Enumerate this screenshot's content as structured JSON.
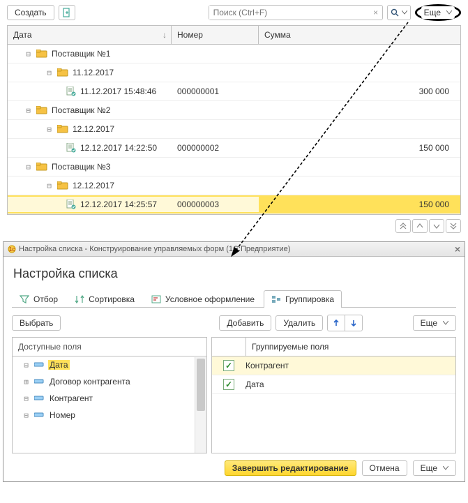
{
  "toolbar": {
    "create_label": "Создать",
    "search_placeholder": "Поиск (Ctrl+F)",
    "more_label": "Еще"
  },
  "columns": {
    "date": "Дата",
    "number": "Номер",
    "sum": "Сумма"
  },
  "rows": [
    {
      "level": 1,
      "kind": "group-supplier",
      "toggle": "-",
      "label": "Поставщик №1"
    },
    {
      "level": 2,
      "kind": "group-date",
      "toggle": "-",
      "label": "11.12.2017"
    },
    {
      "level": 3,
      "kind": "doc",
      "date": "11.12.2017 15:48:46",
      "number": "000000001",
      "sum": "300 000"
    },
    {
      "level": 1,
      "kind": "group-supplier",
      "toggle": "-",
      "label": "Поставщик №2"
    },
    {
      "level": 2,
      "kind": "group-date",
      "toggle": "-",
      "label": "12.12.2017"
    },
    {
      "level": 3,
      "kind": "doc",
      "date": "12.12.2017 14:22:50",
      "number": "000000002",
      "sum": "150 000"
    },
    {
      "level": 1,
      "kind": "group-supplier",
      "toggle": "-",
      "label": "Поставщик №3"
    },
    {
      "level": 2,
      "kind": "group-date",
      "toggle": "-",
      "label": "12.12.2017"
    },
    {
      "level": 3,
      "kind": "doc",
      "highlight": true,
      "date": "12.12.2017 14:25:57",
      "number": "000000003",
      "sum": "150 000"
    }
  ],
  "dialog": {
    "window_title": "Настройка списка - Конструирование управляемых форм  (1С:Предприятие)",
    "title": "Настройка списка",
    "tabs": {
      "filter": "Отбор",
      "sort": "Сортировка",
      "cond": "Условное оформление",
      "group": "Группировка"
    },
    "choose_label": "Выбрать",
    "add_label": "Добавить",
    "delete_label": "Удалить",
    "more_label": "Еще",
    "available_label": "Доступные поля",
    "grouped_label": "Группируемые поля",
    "available_fields": [
      {
        "expand": "-",
        "label": "Дата",
        "selected": true
      },
      {
        "expand": "+",
        "label": "Договор контрагента"
      },
      {
        "expand": "-",
        "label": "Контрагент"
      },
      {
        "expand": "-",
        "label": "Номер"
      }
    ],
    "grouped_fields": [
      {
        "checked": true,
        "label": "Контрагент",
        "selected": true
      },
      {
        "checked": true,
        "label": "Дата"
      }
    ],
    "finish_label": "Завершить редактирование",
    "cancel_label": "Отмена"
  }
}
